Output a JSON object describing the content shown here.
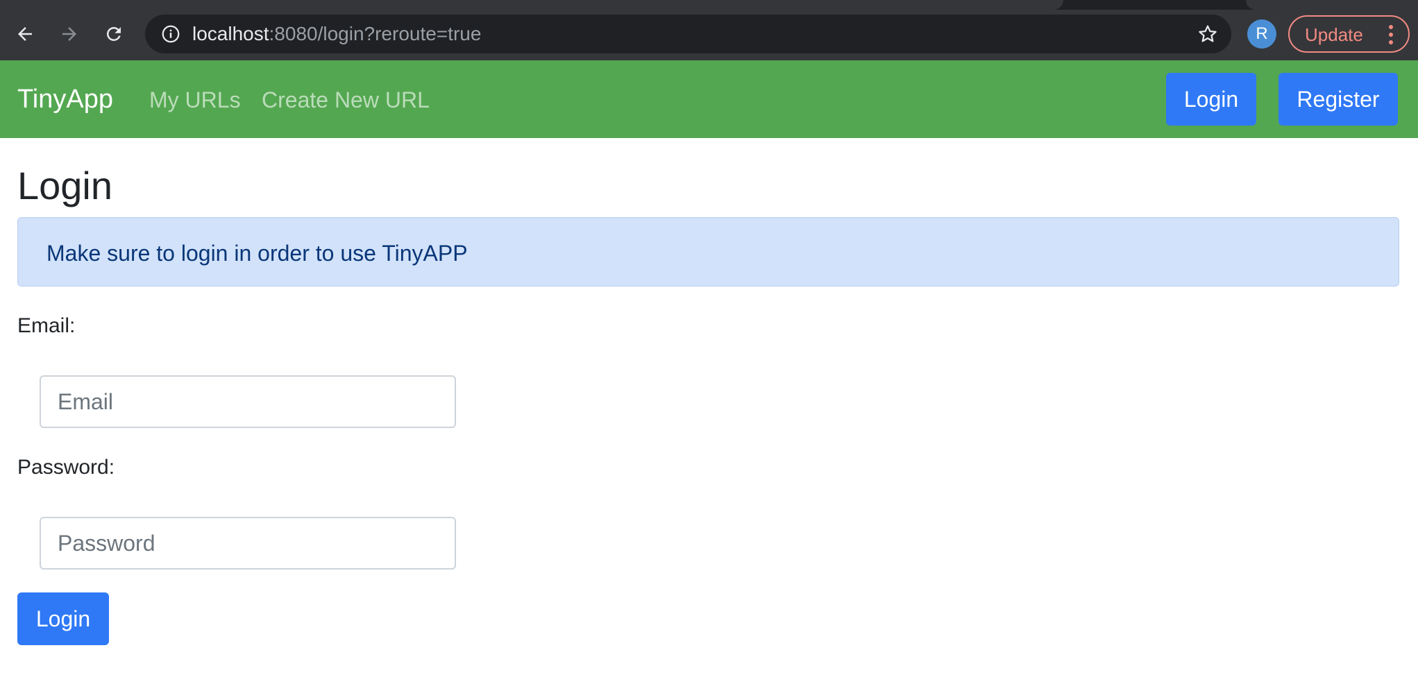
{
  "browser": {
    "url_host": "localhost",
    "url_rest": ":8080/login?reroute=true",
    "profile_initial": "R",
    "update_label": "Update"
  },
  "navbar": {
    "brand": "TinyApp",
    "links": [
      "My URLs",
      "Create New URL"
    ],
    "login_label": "Login",
    "register_label": "Register",
    "background_color": "#54a751",
    "button_color": "#2f79f6"
  },
  "page": {
    "title": "Login",
    "alert_text": "Make sure to login in order to use TinyAPP",
    "form": {
      "email_label": "Email:",
      "email_placeholder": "Email",
      "email_value": "",
      "password_label": "Password:",
      "password_placeholder": "Password",
      "password_value": "",
      "submit_label": "Login"
    }
  },
  "icons": [
    "back-arrow-icon",
    "forward-arrow-icon",
    "reload-icon",
    "info-icon",
    "star-icon",
    "more-vert-icon"
  ]
}
